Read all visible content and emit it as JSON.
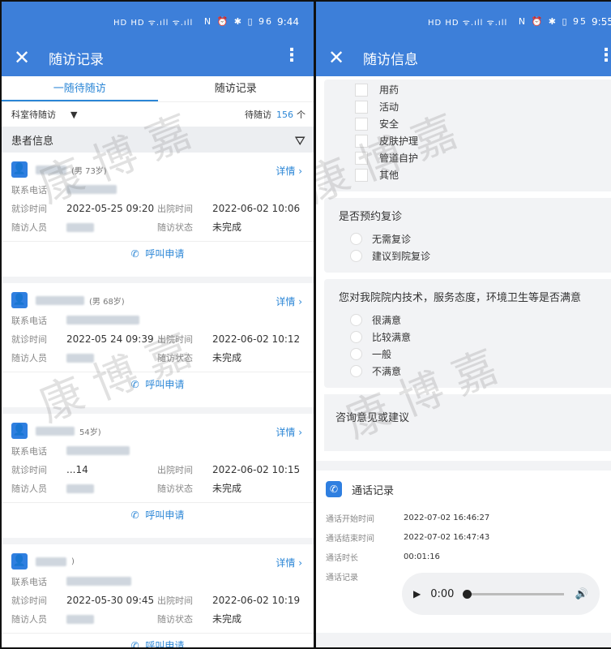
{
  "left": {
    "status": {
      "signal": "HD HD ᯤ.ıll ᯤ.ıll",
      "icons": "N ⏰ ✱ ▯ 96",
      "time": "9:44"
    },
    "appbar": {
      "title": "随访记录"
    },
    "tabs": [
      {
        "label": "一随待随访"
      },
      {
        "label": "随访记录"
      }
    ],
    "filter": {
      "dept": "科室待随访",
      "pending_label": "待随访",
      "count": "156",
      "unit": "个"
    },
    "section": {
      "title": "患者信息"
    },
    "labels": {
      "detail": "详情",
      "phone": "联系电话",
      "visit_time": "就诊时间",
      "discharge_time": "出院时间",
      "staff": "随访人员",
      "state": "随访状态",
      "call": "呼叫申请"
    },
    "records": [
      {
        "gender_age": "(男  73岁)",
        "visit": "2022-05-25 09:20",
        "discharge": "2022-06-02 10:06",
        "state": "未完成"
      },
      {
        "gender_age": "(男  68岁)",
        "visit": "2022-05 24 09:39",
        "discharge": "2022-06-02 10:12",
        "state": "未完成"
      },
      {
        "gender_age": "54岁)",
        "visit": "...14",
        "discharge": "2022-06-02 10:15",
        "state": "未完成"
      },
      {
        "gender_age": ")",
        "visit": "2022-05-30 09:45",
        "discharge": "2022-06-02 10:19",
        "state": "未完成"
      }
    ]
  },
  "right": {
    "status": {
      "signal": "HD HD ᯤ.ıll ᯤ.ıll",
      "icons": "N ⏰ ✱ ▯ 95",
      "time": "9:55"
    },
    "appbar": {
      "title": "随访信息"
    },
    "checks": [
      "用药",
      "活动",
      "安全",
      "皮肤护理",
      "管道自护",
      "其他"
    ],
    "q1": {
      "question": "是否预约复诊",
      "options": [
        "无需复诊",
        "建议到院复诊"
      ]
    },
    "q2": {
      "question": "您对我院院内技术，服务态度，环境卫生等是否满意",
      "options": [
        "很满意",
        "比较满意",
        "一般",
        "不满意"
      ]
    },
    "consult": "咨询意见或建议",
    "call_record": {
      "title": "通话记录",
      "start_label": "通话开始时间",
      "start": "2022-07-02 16:46:27",
      "end_label": "通话结束时间",
      "end": "2022-07-02 16:47:43",
      "dur_label": "通话时长",
      "dur": "00:01:16",
      "rec_label": "通话记录",
      "player_time": "0:00"
    }
  },
  "watermark": "康 博 嘉"
}
